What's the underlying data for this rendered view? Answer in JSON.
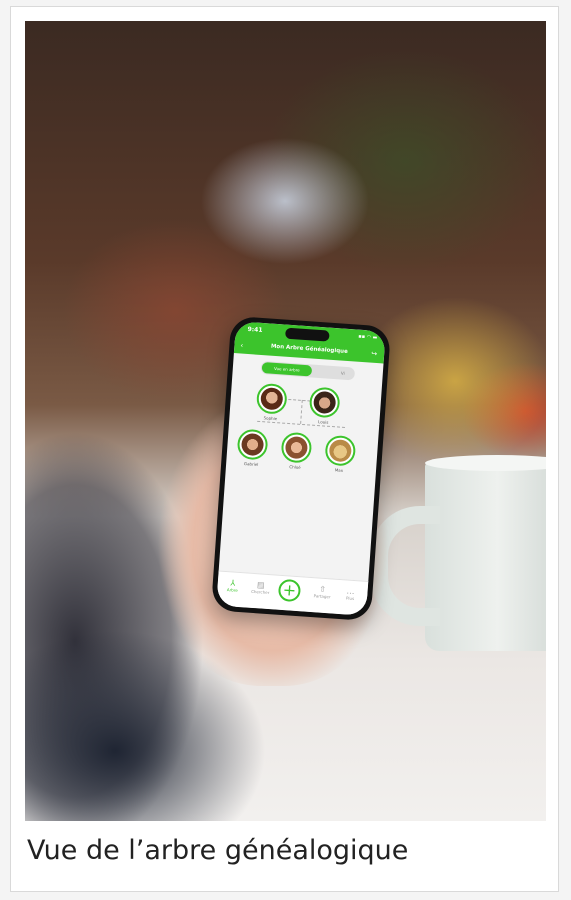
{
  "caption": "Vue de l’arbre généalogique",
  "phone": {
    "time": "9:41",
    "status_icons": "▪▪ ◠ ▬",
    "title": "Mon Arbre Généalogique",
    "segments": {
      "active": "Vue en arbre",
      "inactive": "Vi"
    },
    "people": {
      "sophie": "Sophie",
      "louis": "Louis",
      "gabriel": "Gabriel",
      "chloe": "Chloé",
      "max": "Max"
    },
    "tabs": {
      "arbre": "Arbre",
      "chercher": "Chercher",
      "partager": "Partager",
      "plus": "Plus"
    },
    "accent_color": "#3cc42c",
    "icons": {
      "back": "back-icon",
      "share": "share-icon",
      "tree": "tree-icon",
      "search": "search-icon",
      "add": "plus-icon",
      "upload": "upload-icon",
      "more": "more-icon"
    }
  }
}
